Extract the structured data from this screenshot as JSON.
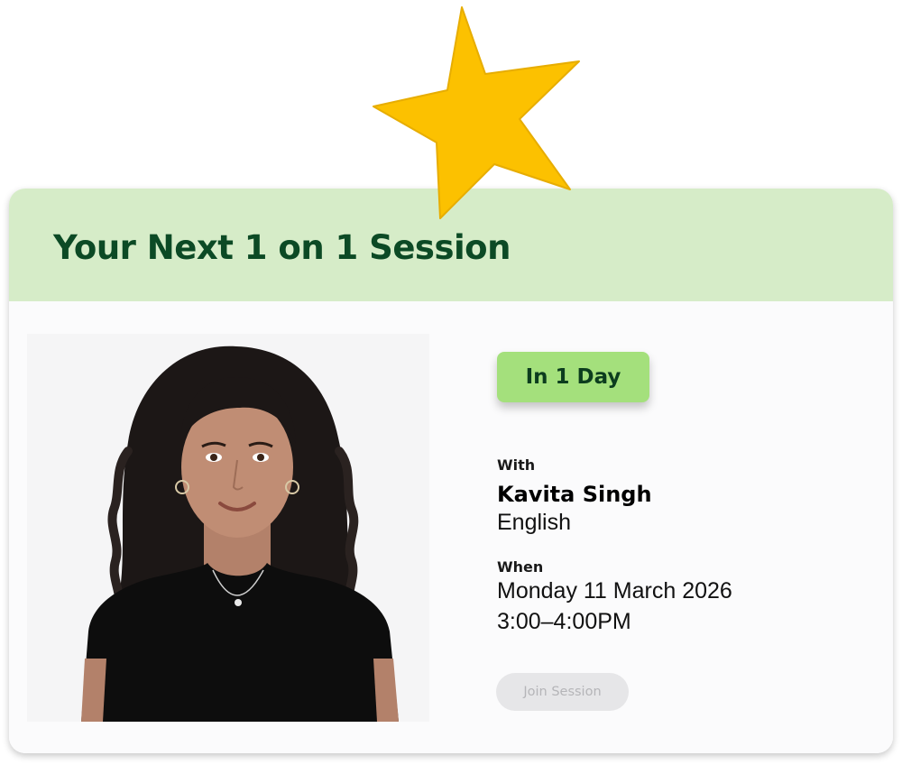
{
  "card": {
    "title": "Your Next 1 on 1 Session",
    "badge": "In 1 Day",
    "with_label": "With",
    "tutor_name": "Kavita Singh",
    "subject": "English",
    "when_label": "When",
    "date": "Monday 11 March 2026",
    "time": "3:00–4:00PM",
    "join_button": "Join Session"
  },
  "icons": {
    "star": "star-icon",
    "photo": "tutor-photo"
  },
  "colors": {
    "header_bg": "#d6ecc8",
    "title": "#0c4a25",
    "badge_bg": "#a4e07c",
    "star": "#fcc100",
    "button_disabled_bg": "#e6e6e8",
    "button_disabled_text": "#b5b5b8"
  }
}
